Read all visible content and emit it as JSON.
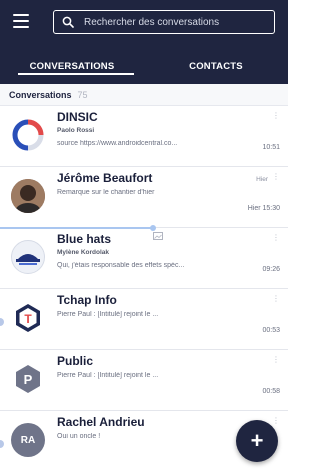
{
  "header": {
    "search_placeholder": "Rechercher des conversations",
    "tabs": [
      {
        "label": "CONVERSATIONS",
        "active": true
      },
      {
        "label": "CONTACTS",
        "active": false
      }
    ]
  },
  "section": {
    "title": "Conversations",
    "count": "75"
  },
  "conversations": [
    {
      "title": "DINSIC",
      "subtitle": "Paolo Rossi",
      "message": "source https://www.androidcentral.co...",
      "time": "10:51",
      "avatar_icon": "dinsic-logo-icon"
    },
    {
      "title": "Jérôme Beaufort",
      "subtitle": "",
      "message": "Remarque sur le chantier d'hier",
      "time": "Hier 15:30",
      "date": "Hier",
      "avatar_icon": "person-avatar-icon"
    },
    {
      "title": "Blue hats",
      "subtitle": "Mylène Kordolak",
      "message": "Qui, j'étais responsable des effets spéc...",
      "time": "09:26",
      "avatar_icon": "blue-hats-logo-icon"
    },
    {
      "title": "Tchap Info",
      "subtitle": "",
      "message": "Pierre Paul : [Intitulé] rejoint le ...",
      "time": "00:53",
      "avatar_icon": "tchap-logo-icon"
    },
    {
      "title": "Public",
      "subtitle": "",
      "message": "Pierre Paul : [Intitulé] rejoint le ...",
      "time": "00:58",
      "avatar_letter": "P",
      "avatar_icon": "hexagon-letter-icon"
    },
    {
      "title": "Rachel Andrieu",
      "subtitle": "",
      "message": "Oui un oncle !",
      "time": "",
      "avatar_letter": "RA",
      "avatar_icon": "initials-avatar-icon"
    }
  ],
  "fab": {
    "label": "+"
  },
  "colors": {
    "header_bg": "#1f2540",
    "accent": "#1f2540",
    "section_bg": "#f7f8fa",
    "avatar_grey": "#6f7489"
  }
}
